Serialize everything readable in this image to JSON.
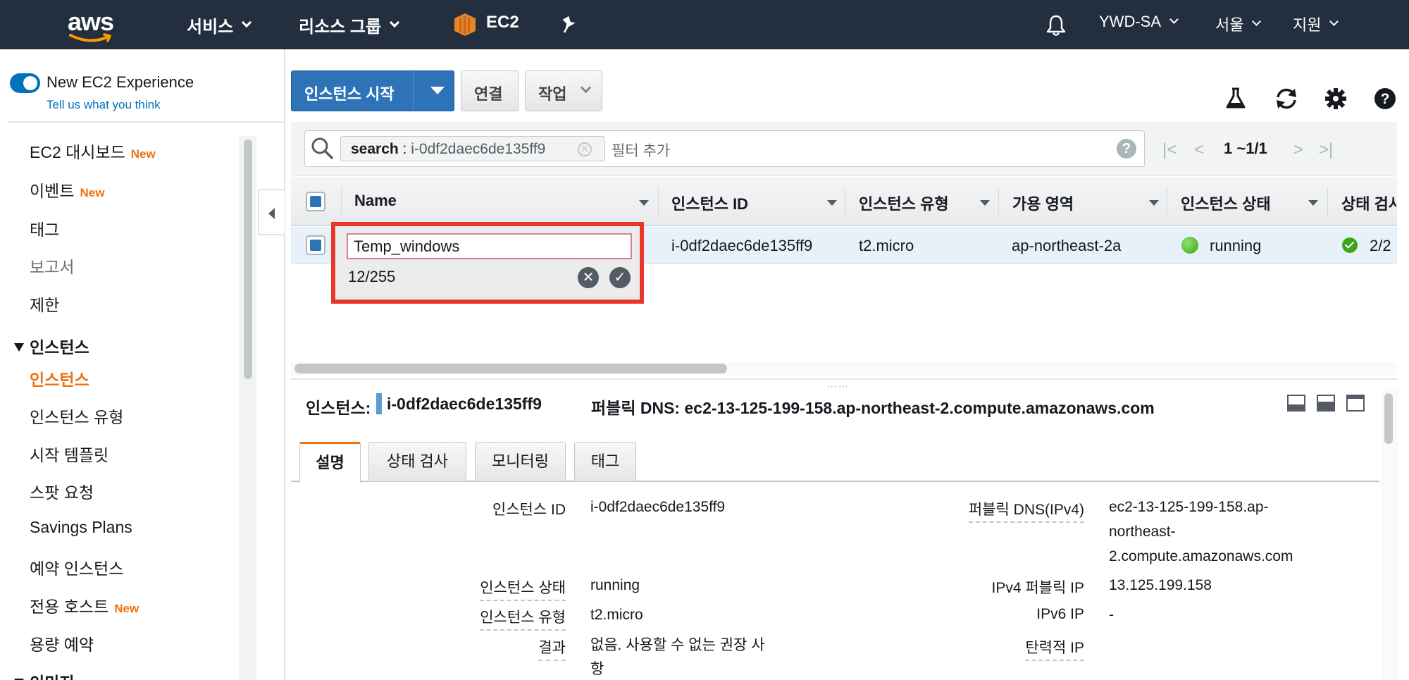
{
  "topnav": {
    "logo_text": "aws",
    "services": "서비스",
    "resource_groups": "리소스 그룹",
    "service_name": "EC2",
    "account": "YWD-SA",
    "region": "서울",
    "support": "지원",
    "icons": [
      "ec2-icon",
      "pin-icon",
      "bell-icon"
    ]
  },
  "sidebar": {
    "new_experience": "New EC2 Experience",
    "tell_us": "Tell us what you think",
    "badge_new": "New",
    "items": [
      {
        "label": "EC2 대시보드",
        "new": true
      },
      {
        "label": "이벤트",
        "new": true
      },
      {
        "label": "태그"
      },
      {
        "label": "보고서"
      },
      {
        "label": "제한"
      }
    ],
    "section_instances": "인스턴스",
    "instance_items": [
      {
        "label": "인스턴스"
      },
      {
        "label": "인스턴스 유형"
      },
      {
        "label": "시작 템플릿"
      },
      {
        "label": "스팟 요청"
      },
      {
        "label": "Savings Plans"
      },
      {
        "label": "예약 인스턴스"
      },
      {
        "label": "전용 호스트",
        "new": true
      },
      {
        "label": "용량 예약"
      }
    ],
    "section_images": "이미지"
  },
  "toolbar": {
    "launch_label": "인스턴스 시작",
    "connect_label": "연결",
    "actions_label": "작업"
  },
  "search": {
    "token_key": "search",
    "token_value": "i-0df2daec6de135ff9",
    "placeholder": "필터 추가",
    "pager": "1 ~1/1"
  },
  "table": {
    "columns": [
      "Name",
      "인스턴스 ID",
      "인스턴스 유형",
      "가용 영역",
      "인스턴스 상태",
      "상태 검사"
    ],
    "rows": [
      {
        "instance_id": "i-0df2daec6de135ff9",
        "type": "t2.micro",
        "az": "ap-northeast-2a",
        "state": "running",
        "checks": "2/2"
      }
    ]
  },
  "edit_name": {
    "value": "Temp_windows",
    "count": "12/255"
  },
  "detail": {
    "instance_label": "인스턴스:",
    "instance_id": "i-0df2daec6de135ff9",
    "public_dns_header": "퍼블릭 DNS: ec2-13-125-199-158.ap-northeast-2.compute.amazonaws.com",
    "tabs": [
      "설명",
      "상태 검사",
      "모니터링",
      "태그"
    ],
    "left_fields": [
      {
        "label": "인스턴스 ID",
        "value": "i-0df2daec6de135ff9"
      },
      {
        "label": "인스턴스 상태",
        "value": "running"
      },
      {
        "label": "인스턴스 유형",
        "value": "t2.micro"
      },
      {
        "label": "결과",
        "value_lines": [
          "없음. 사용할 수 없는 권장 사",
          "항"
        ]
      }
    ],
    "right_fields": [
      {
        "label": "퍼블릭 DNS(IPv4)",
        "value_lines": [
          "ec2-13-125-199-158.ap-",
          "northeast-",
          "2.compute.amazonaws.com"
        ]
      },
      {
        "label": "IPv4 퍼블릭 IP",
        "value": "13.125.199.158"
      },
      {
        "label": "IPv6 IP",
        "value": "-"
      },
      {
        "label": "탄력적 IP",
        "value": ""
      }
    ]
  },
  "colors": {
    "nav_bg": "#232f3e",
    "accent_orange": "#ec7211",
    "primary_blue": "#2e73b8",
    "highlight_red": "#e8372a",
    "running_green": "#3ba619"
  }
}
